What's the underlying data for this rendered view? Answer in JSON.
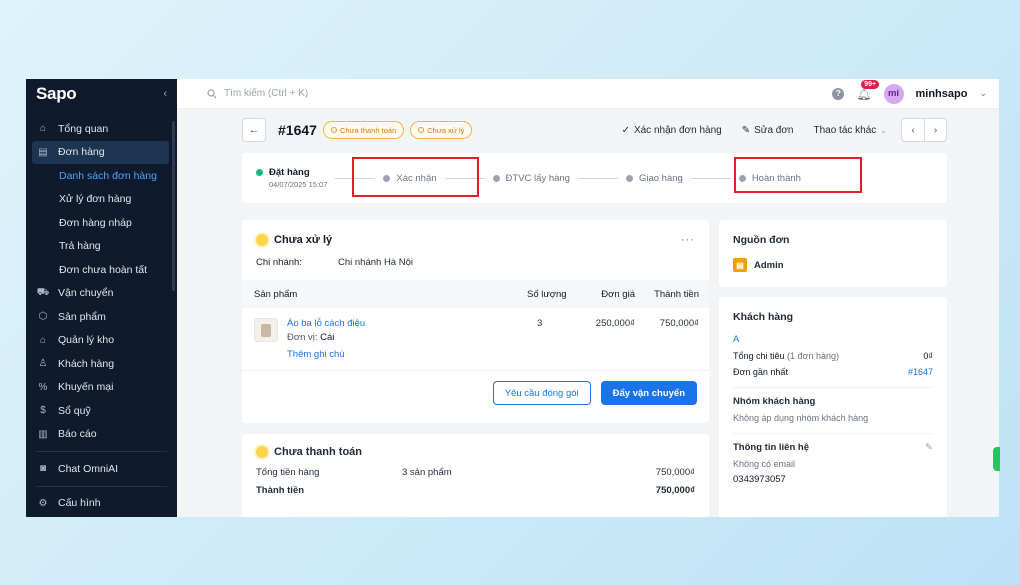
{
  "sidebar": {
    "logo": "Sapo",
    "collapse": "‹",
    "items": [
      {
        "label": "Tổng quan",
        "icon": "home-icon"
      },
      {
        "label": "Đơn hàng",
        "icon": "order-icon"
      },
      {
        "label": "Vận chuyển",
        "icon": "truck-icon"
      },
      {
        "label": "Sản phẩm",
        "icon": "box-icon"
      },
      {
        "label": "Quản lý kho",
        "icon": "warehouse-icon"
      },
      {
        "label": "Khách hàng",
        "icon": "user-icon"
      },
      {
        "label": "Khuyến mại",
        "icon": "discount-icon"
      },
      {
        "label": "Sổ quỹ",
        "icon": "cashbook-icon"
      },
      {
        "label": "Báo cáo",
        "icon": "chart-icon"
      },
      {
        "label": "Chat OmniAI",
        "icon": "chat-icon"
      },
      {
        "label": "Cấu hình",
        "icon": "gear-icon"
      }
    ],
    "sub_items": [
      "Danh sách đơn hàng",
      "Xử lý đơn hàng",
      "Đơn hàng nháp",
      "Trả hàng",
      "Đơn chưa hoàn tất"
    ]
  },
  "topbar": {
    "search_placeholder": "Tìm kiếm (Ctrl + K)",
    "notif_badge": "99+",
    "avatar": "mi",
    "username": "minhsapo"
  },
  "order": {
    "id": "#1647",
    "payment_status": "Chưa thanh toán",
    "process_status": "Chưa xử lý",
    "actions": {
      "confirm": "Xác nhận đơn hàng",
      "edit": "Sửa đơn",
      "more": "Thao tác khác"
    }
  },
  "steps": [
    {
      "label": "Đặt hàng",
      "sub": "04/07/2025 15:07"
    },
    {
      "label": "Xác nhận"
    },
    {
      "label": "ĐTVC lấy hàng"
    },
    {
      "label": "Giao hàng"
    },
    {
      "label": "Hoàn thành"
    }
  ],
  "fulfillment": {
    "title": "Chưa xử lý",
    "more": "···",
    "branch_label": "Chi nhánh:",
    "branch_value": "Chi nhánh Hà Nội",
    "columns": [
      "Sản phẩm",
      "Số lượng",
      "Đơn giá",
      "Thành tiền"
    ],
    "product": {
      "name": "Áo ba lỗ cách điệu",
      "unit_label": "Đơn vị:",
      "unit": "Cái",
      "note": "Thêm ghi chú",
      "qty": "3",
      "price": "250,000₫",
      "total": "750,000₫"
    },
    "btn_pack": "Yêu cầu đóng gói",
    "btn_ship": "Đẩy vận chuyển"
  },
  "payment": {
    "title": "Chưa thanh toán",
    "subtotal_label": "Tổng tiền hàng",
    "subtotal_count": "3 sản phẩm",
    "subtotal_value": "750,000₫",
    "total_label": "Thành tiền",
    "total_value": "750,000₫"
  },
  "source": {
    "title": "Nguồn đơn",
    "value": "Admin"
  },
  "customer": {
    "title": "Khách hàng",
    "name": "A",
    "spent_label": "Tổng chi tiêu",
    "spent_count": "(1 đơn hàng)",
    "spent_value": "0₫",
    "last_label": "Đơn gần nhất",
    "last_value": "#1647",
    "group_title": "Nhóm khách hàng",
    "group_value": "Không áp dụng nhóm khách hàng",
    "contact_title": "Thông tin liên hệ",
    "email": "Không có email",
    "phone": "0343973057"
  },
  "colors": {
    "sidebar": "#0f1b2d",
    "accent": "#1a73e8",
    "highlight": "#e11d2a",
    "done": "#10b981"
  }
}
